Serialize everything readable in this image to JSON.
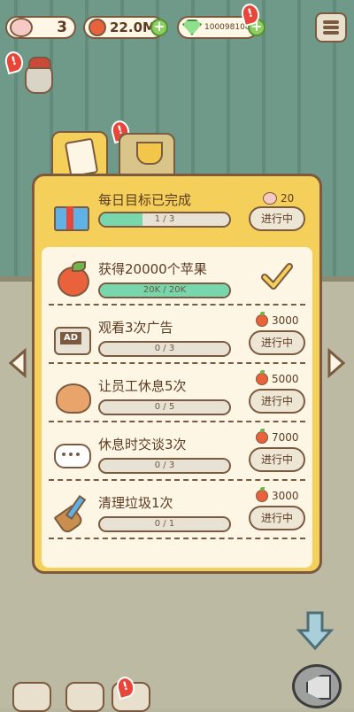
{
  "top_bar": {
    "paw_count": "3",
    "apple_total": "22.0M",
    "gem_total": "100098100",
    "colors": {
      "pill_bg": "#fff7e6",
      "border": "#7b5a3f",
      "plus": "#8bcf5c"
    }
  },
  "header": {
    "title": "每日目标已完成",
    "reward": "20",
    "progress_text": "1 / 3",
    "progress": 0.33,
    "button": "进行中"
  },
  "tasks": [
    {
      "icon": "apple-icon",
      "title": "获得20000个苹果",
      "progress_text": "20K / 20K",
      "progress": 1.0,
      "reward": "",
      "status": "completed"
    },
    {
      "icon": "ad-tv-icon",
      "title": "观看3次广告",
      "progress_text": "0 / 3",
      "progress": 0,
      "reward": "3000",
      "button": "进行中"
    },
    {
      "icon": "bread-icon",
      "title": "让员工休息5次",
      "progress_text": "0 / 5",
      "progress": 0,
      "reward": "5000",
      "button": "进行中"
    },
    {
      "icon": "chat-bubble-icon",
      "title": "休息时交谈3次",
      "progress_text": "0 / 3",
      "progress": 0,
      "reward": "7000",
      "button": "进行中"
    },
    {
      "icon": "broom-icon",
      "title": "清理垃圾1次",
      "progress_text": "0 / 1",
      "progress": 0,
      "reward": "3000",
      "button": "进行中"
    }
  ],
  "colors": {
    "panel": "#f4d05a",
    "inner": "#fdf6e4",
    "bar_fill": "#77d6ab",
    "wall": "#6f9a8a",
    "floor": "#bdbaa4"
  }
}
